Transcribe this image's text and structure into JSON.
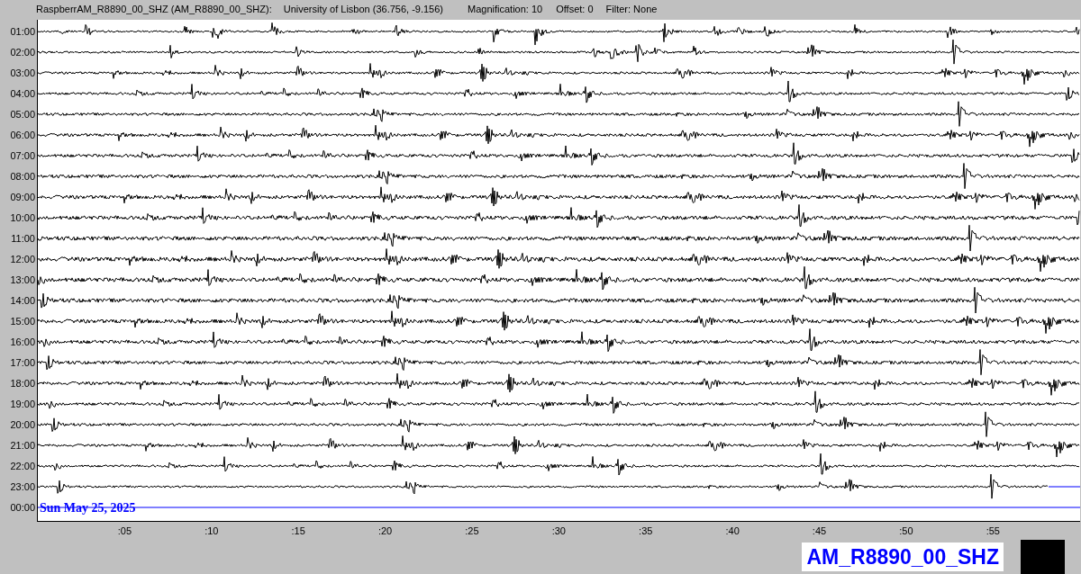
{
  "header": {
    "station": "RaspberrAM_R8890_00_SHZ (AM_R8890_00_SHZ):",
    "location": "University of Lisbon (36.756, -9.156)",
    "magnification": "Magnification: 10",
    "offset": "Offset: 0",
    "filter": "Filter: None"
  },
  "hours": [
    "01:00",
    "02:00",
    "03:00",
    "04:00",
    "05:00",
    "06:00",
    "07:00",
    "08:00",
    "09:00",
    "10:00",
    "11:00",
    "12:00",
    "13:00",
    "14:00",
    "15:00",
    "16:00",
    "17:00",
    "18:00",
    "19:00",
    "20:00",
    "21:00",
    "22:00",
    "23:00",
    "00:00"
  ],
  "date_label": "Sun May 25, 2025",
  "minute_ticks": [
    ":05",
    ":10",
    ":15",
    ":20",
    ":25",
    ":30",
    ":35",
    ":40",
    ":45",
    ":50",
    ":55"
  ],
  "station_label": "AM_R8890_00_SHZ"
}
